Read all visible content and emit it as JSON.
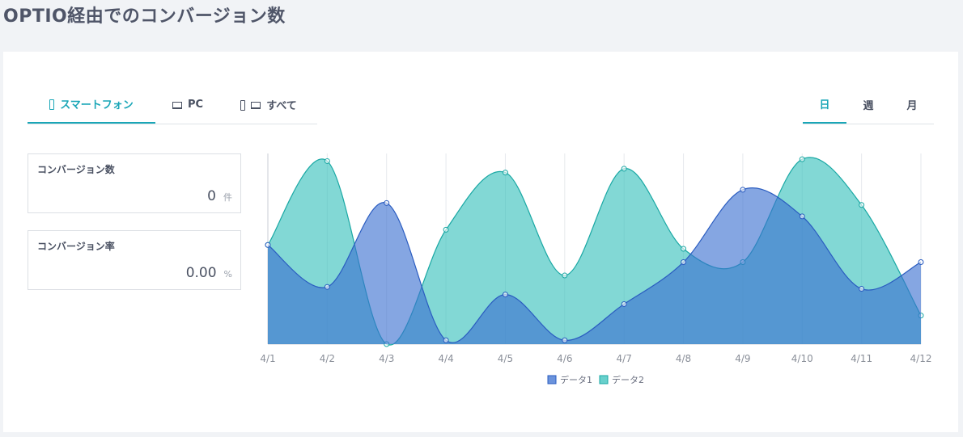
{
  "page": {
    "title": "OPTIO経由でのコンバージョン数"
  },
  "device_tabs": {
    "smartphone": "スマートフォン",
    "pc": "PC",
    "all": "すべて"
  },
  "period_tabs": {
    "day": "日",
    "week": "週",
    "month": "月"
  },
  "kpis": {
    "conversions": {
      "label": "コンバージョン数",
      "value": "0",
      "unit": "件"
    },
    "rate": {
      "label": "コンバージョン率",
      "value": "0.00",
      "unit": "%"
    }
  },
  "colors": {
    "accent": "#1aa6b7",
    "series1_fill": "#3a6fd0",
    "series1_line": "#2a5cc0",
    "series2_fill": "#36c0bb",
    "series2_line": "#1aa8a4"
  },
  "icons": {
    "smartphone": "smartphone-icon",
    "pc": "laptop-icon"
  },
  "chart_data": {
    "type": "area",
    "categories": [
      "4/1",
      "4/2",
      "4/3",
      "4/4",
      "4/5",
      "4/6",
      "4/7",
      "4/8",
      "4/9",
      "4/10",
      "4/11",
      "4/12"
    ],
    "series": [
      {
        "name": "データ1",
        "values": [
          52,
          30,
          74,
          2,
          26,
          2,
          21,
          43,
          81,
          67,
          29,
          43
        ]
      },
      {
        "name": "データ2",
        "values": [
          52,
          96,
          0,
          60,
          90,
          36,
          92,
          50,
          43,
          97,
          73,
          15
        ]
      }
    ],
    "ylim": [
      0,
      100
    ],
    "grid": "vertical",
    "legend": "bottom-center"
  }
}
